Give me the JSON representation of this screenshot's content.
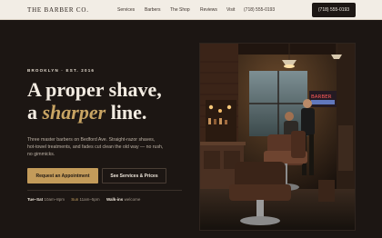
{
  "header": {
    "logo": "THE BARBER CO.",
    "nav": [
      "Services",
      "Barbers",
      "The Shop",
      "Reviews",
      "Visit"
    ],
    "phone": "(718) 555-0193",
    "phone_button": "(718) 555-0193"
  },
  "hero": {
    "eyebrow": "BROOKLYN · EST. 2016",
    "headline_line1": "A proper shave,",
    "headline_a": "a ",
    "headline_accent": "sharper",
    "headline_end": " line.",
    "description": "Three master barbers on Bedford Ave. Straight-razor shaves, hot-towel treatments, and fades cut clean the old way — no rush, no gimmicks.",
    "primary_cta": "Request an Appointment",
    "secondary_cta": "See Services & Prices",
    "hours": {
      "weekday_label": "Tue–Sat",
      "weekday_time": "10am–8pm",
      "sunday_label": "Sun",
      "sunday_time": "11am–5pm",
      "walkins_label": "Walk-ins",
      "walkins_note": "welcome"
    },
    "photo_sign": "BARBER"
  },
  "colors": {
    "background": "#1c1613",
    "accent_gold": "#c8a463",
    "header_bg": "#f2ede5"
  }
}
